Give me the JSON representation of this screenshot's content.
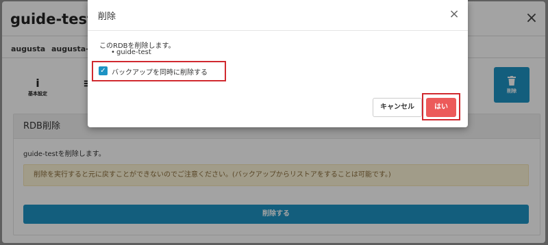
{
  "panel": {
    "title": "guide-test",
    "close_glyph": "×",
    "breadcrumb": [
      "augusta",
      "augusta-r"
    ],
    "tools": [
      {
        "label": "基本設定",
        "icon": "info-icon",
        "glyph": "i"
      },
      {
        "label": "",
        "icon": "list-icon",
        "glyph": "≡"
      }
    ],
    "delete_tile": {
      "label": "削除",
      "icon": "trash-icon"
    },
    "card_title": "RDB削除",
    "card_text": "guide-testを削除します。",
    "warning": "削除を実行すると元に戻すことができないのでご注意ください。(バックアップからリストアをすることは可能です。)",
    "delete_button": "削除する"
  },
  "dialog": {
    "title": "削除",
    "close_glyph": "×",
    "message": "このRDBを削除します。",
    "items": [
      "guide-test"
    ],
    "checkbox": {
      "label": "バックアップを同時に削除する",
      "checked": true
    },
    "cancel_label": "キャンセル",
    "confirm_label": "はい"
  },
  "colors": {
    "primary": "#1d93c4",
    "danger": "#ec5a5a",
    "highlight": "#d0282e",
    "warning_bg": "#fcf3d6"
  }
}
